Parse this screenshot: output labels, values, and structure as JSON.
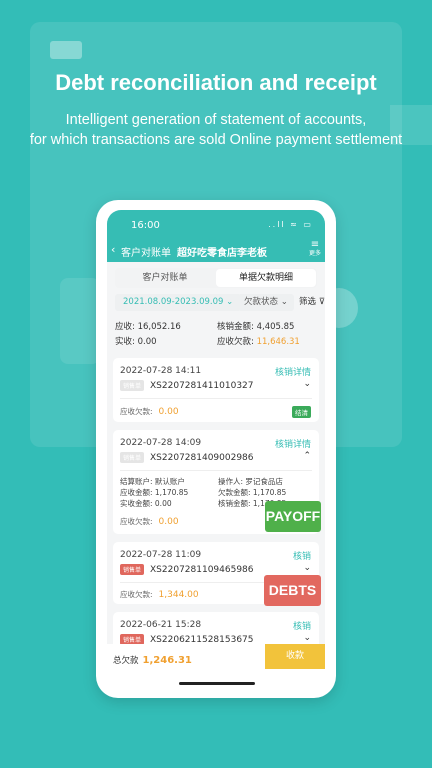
{
  "promo": {
    "headline": "Debt reconciliation and receipt",
    "sub1": "Intelligent generation of statement of accounts,",
    "sub2": "for which transactions are sold Online payment settlement"
  },
  "status": {
    "time": "16:00",
    "icons": "..ll ≈ ▭"
  },
  "nav": {
    "back_label": "客户对账单",
    "title": "超好吃零食店李老板",
    "more_label": "更多"
  },
  "tabs": [
    {
      "label": "客户对账单",
      "active": false
    },
    {
      "label": "单据欠款明细",
      "active": true
    }
  ],
  "filters": {
    "date_range": "2021.08.09-2023.09.09",
    "debt_status": "欠款状态",
    "filter": "筛选"
  },
  "summary": {
    "receivable_label": "应收:",
    "receivable": "16,052.16",
    "writeoff_label": "核销金额:",
    "writeoff": "4,405.85",
    "received_label": "实收:",
    "received": "0.00",
    "due_label": "应收欠款:",
    "due": "11,646.31"
  },
  "cards": [
    {
      "date": "2022-07-28 14:11",
      "link": "核销详情",
      "tag": "销售单",
      "order": "XS2207281411010327",
      "due_label": "应收欠款:",
      "due": "0.00",
      "status": "结清"
    },
    {
      "date": "2022-07-28 14:09",
      "link": "核销详情",
      "tag": "销售单",
      "order": "XS2207281409002986",
      "account": "结算账户: 默认账户",
      "operator": "操作人: 罗记食品店",
      "receivable": "应收金额: 1,170.85",
      "debt": "欠款金额: 1,170.85",
      "received": "实收金额: 0.00",
      "writeoff": "核销金额: 1,170.85",
      "due_label": "应收欠款:",
      "due": "0.00"
    },
    {
      "date": "2022-07-28 11:09",
      "link": "核销",
      "tag": "销售单",
      "order": "XS2207281109465986",
      "due_label": "应收欠款:",
      "due": "1,344.00"
    },
    {
      "date": "2022-06-21 15:28",
      "link": "核销",
      "tag": "销售单",
      "order": "XS2206211528153675"
    }
  ],
  "badges": {
    "payoff": "PAYOFF",
    "debts": "DEBTS"
  },
  "bottom": {
    "total_label": "总欠款",
    "total": "1,246.31",
    "collect": "收款"
  },
  "colors": {
    "accent": "#36bdb4",
    "background": "#33bdb7",
    "orange": "#f0a030",
    "payoff": "#4fb04a",
    "debts": "#e2685f",
    "collect": "#f2c33b"
  }
}
